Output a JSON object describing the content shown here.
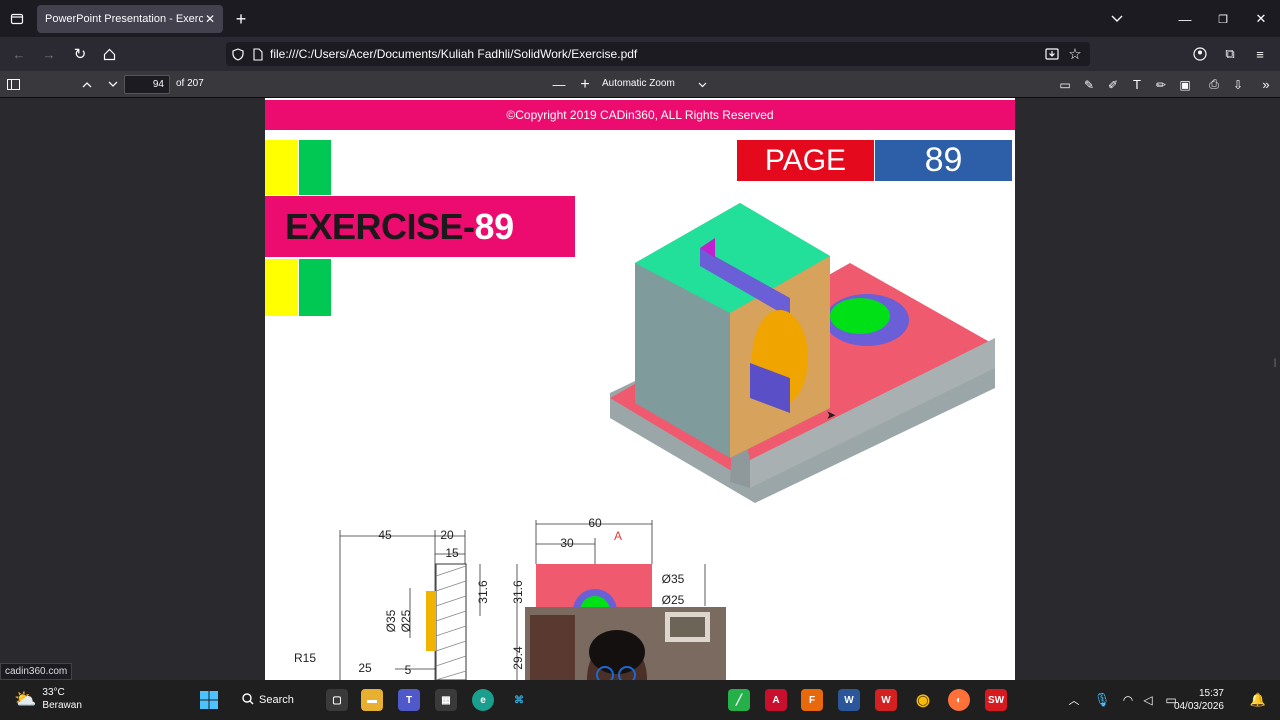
{
  "tab": {
    "title": "PowerPoint Presentation - Exercise.pdf"
  },
  "address": {
    "url": "file:///C:/Users/Acer/Documents/Kuliah Fadhli/SolidWork/Exercise.pdf"
  },
  "pdf_toolbar": {
    "page_number": "94",
    "page_count": "of 207",
    "zoom": "Automatic Zoom"
  },
  "document": {
    "copyright": "©Copyright 2019 CADin360, ALL Rights Reserved",
    "exercise_prefix": "EXERCISE-",
    "exercise_number": "89",
    "page_label": "PAGE",
    "page_value": "89",
    "dims": {
      "d45": "45",
      "d20": "20",
      "d15": "15",
      "d31_6": "31.6",
      "d35": "Ø35",
      "d25": "Ø25",
      "r15": "R15",
      "d25b": "25",
      "d5": "5",
      "d60": "60",
      "d30": "30",
      "a": "A",
      "d31_6b": "31.6",
      "d29_4": "29.4",
      "phi35": "Ø35",
      "phi25": "Ø25"
    }
  },
  "status_link": "cadin360.com",
  "taskbar": {
    "temp": "33°C",
    "weather": "Berawan",
    "search": "Search",
    "time": "15:37",
    "date": "04/03/2026"
  },
  "colors": {
    "brand_pink": "#ec0b6e",
    "page_red": "#e5091d",
    "page_blue": "#2d5ea8",
    "yellow": "#ffff00",
    "green": "#00c853"
  }
}
